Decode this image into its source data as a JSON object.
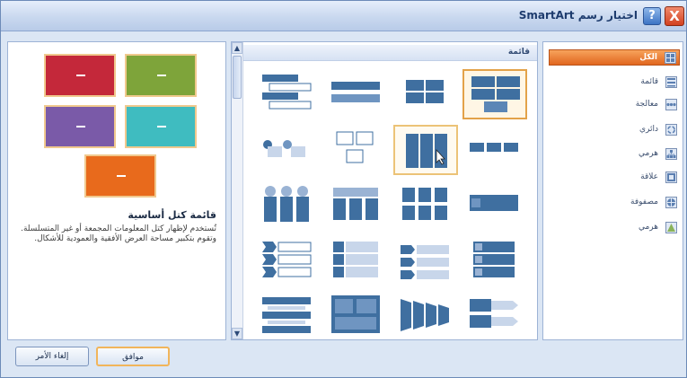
{
  "window": {
    "title": "اختيار رسم SmartArt",
    "close_glyph": "X",
    "help_glyph": "?"
  },
  "categories": [
    {
      "label": "الكل",
      "icon": "grid-icon",
      "selected": true
    },
    {
      "label": "قائمة",
      "icon": "list-icon"
    },
    {
      "label": "معالجة",
      "icon": "process-icon"
    },
    {
      "label": "دائري",
      "icon": "cycle-icon"
    },
    {
      "label": "هرمي",
      "icon": "hierarchy-icon"
    },
    {
      "label": "علاقة",
      "icon": "relationship-icon"
    },
    {
      "label": "مصفوفة",
      "icon": "matrix-icon"
    },
    {
      "label": "هرمي",
      "icon": "pyramid-icon"
    }
  ],
  "gallery": {
    "header": "قائمة",
    "scroll_up": "▲",
    "scroll_down": "▼",
    "selected_index": 0,
    "hover_index": 5,
    "item_count": 20
  },
  "preview": {
    "title": "قائمة كتل أساسية",
    "description": "تُستخدم لإظهار كتل المعلومات المجمعة أو غير المتسلسلة. وتقوم بتكبير مساحة العرض الأفقية والعمودية للأشكال.",
    "colors": [
      "#c4283a",
      "#7ea43a",
      "#7a5aa8",
      "#3fbcc0",
      "#e86a1c"
    ]
  },
  "buttons": {
    "ok": "موافق",
    "cancel": "إلغاء الأمر"
  },
  "colors": {
    "accent": "#e3a249",
    "selected_category": "#e1661e",
    "shape_blue": "#3f6fa0"
  }
}
